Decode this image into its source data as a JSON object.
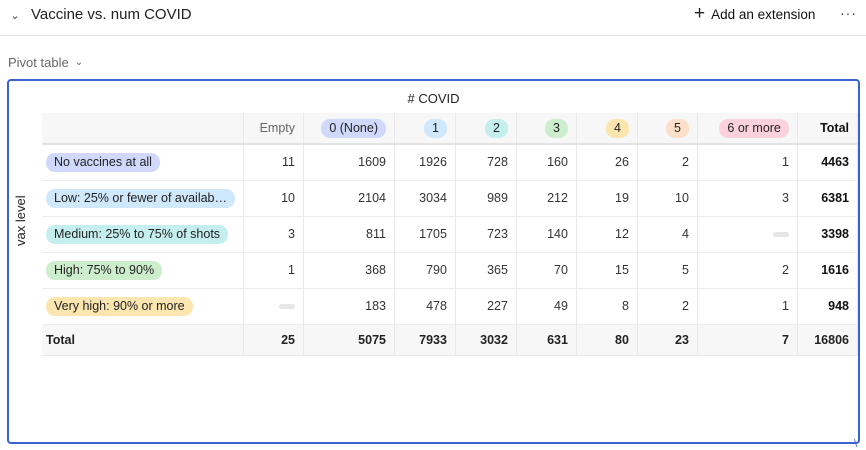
{
  "header": {
    "title": "Vaccine vs. num COVID",
    "add_extension_label": "Add an extension",
    "more_label": "···"
  },
  "view": {
    "label": "Pivot table"
  },
  "pivot": {
    "column_field": "# COVID",
    "row_field": "vax level",
    "columns": [
      {
        "label": "Empty",
        "pill": false,
        "color": ""
      },
      {
        "label": "0 (None)",
        "pill": true,
        "color": "#d0d9fb"
      },
      {
        "label": "1",
        "pill": true,
        "color": "#cfe8fc"
      },
      {
        "label": "2",
        "pill": true,
        "color": "#c5efee"
      },
      {
        "label": "3",
        "pill": true,
        "color": "#cdeecd"
      },
      {
        "label": "4",
        "pill": true,
        "color": "#fbe6b0"
      },
      {
        "label": "5",
        "pill": true,
        "color": "#fde0cc"
      },
      {
        "label": "6 or more",
        "pill": true,
        "color": "#fbd2dc"
      }
    ],
    "total_label": "Total",
    "rows": [
      {
        "label": "No vaccines at all",
        "color": "#d0d9fb",
        "values": [
          "11",
          "1609",
          "1926",
          "728",
          "160",
          "26",
          "2",
          "1"
        ],
        "total": "4463"
      },
      {
        "label": "Low: 25% or fewer of availab…",
        "color": "#cfe8fc",
        "values": [
          "10",
          "2104",
          "3034",
          "989",
          "212",
          "19",
          "10",
          "3"
        ],
        "total": "6381"
      },
      {
        "label": "Medium: 25% to 75% of shots",
        "color": "#c5efee",
        "values": [
          "3",
          "811",
          "1705",
          "723",
          "140",
          "12",
          "4",
          ""
        ],
        "total": "3398"
      },
      {
        "label": "High: 75% to 90%",
        "color": "#cdeecd",
        "values": [
          "1",
          "368",
          "790",
          "365",
          "70",
          "15",
          "5",
          "2"
        ],
        "total": "1616"
      },
      {
        "label": "Very high: 90% or more",
        "color": "#fbe6b0",
        "values": [
          "",
          "183",
          "478",
          "227",
          "49",
          "8",
          "2",
          "1"
        ],
        "total": "948"
      }
    ],
    "totals_row": {
      "label": "Total",
      "values": [
        "25",
        "5075",
        "7933",
        "3032",
        "631",
        "80",
        "23",
        "7"
      ],
      "total": "16806"
    }
  }
}
